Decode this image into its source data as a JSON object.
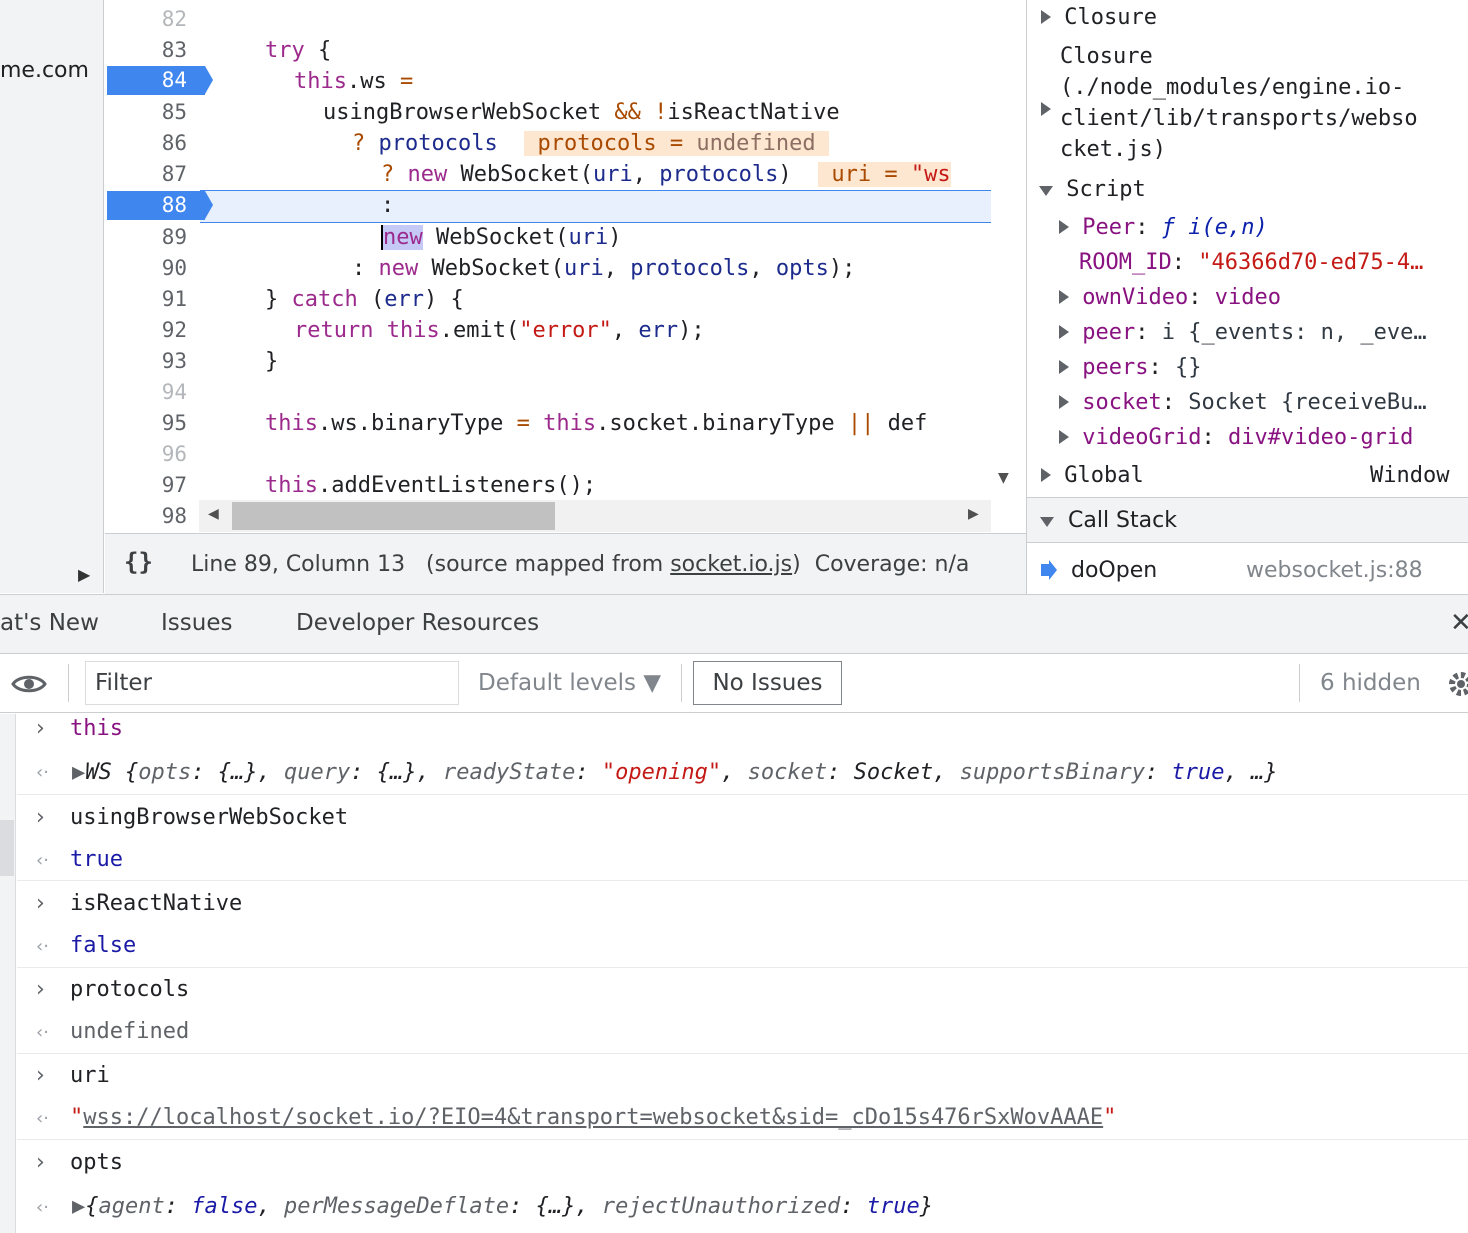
{
  "left_panel": {
    "url_fragment": "me.com",
    "expand_glyph": "▶"
  },
  "editor": {
    "lines": [
      {
        "n": "82"
      },
      {
        "n": "83"
      },
      {
        "n": "84"
      },
      {
        "n": "85"
      },
      {
        "n": "86"
      },
      {
        "n": "87"
      },
      {
        "n": "88"
      },
      {
        "n": "89"
      },
      {
        "n": "90"
      },
      {
        "n": "91"
      },
      {
        "n": "92"
      },
      {
        "n": "93"
      },
      {
        "n": "94"
      },
      {
        "n": "95"
      },
      {
        "n": "96"
      },
      {
        "n": "97"
      },
      {
        "n": "98"
      }
    ],
    "code": {
      "l83_try": "try",
      "l83_brace": " {",
      "l84_this": "this",
      "l84_rest": ".ws ",
      "l84_eq": "=",
      "l85_ident": "usingBrowserWebSocket ",
      "l85_and": "&&",
      "l85_not": " !",
      "l85_rn": "isReactNative",
      "l86_q": "? ",
      "l86_protocols": "protocols",
      "l86_inline": "protocols = ",
      "l86_inline_val": "undefined",
      "l87_q": "? ",
      "l87_new": "new",
      "l87_ws": " WebSocket(",
      "l87_uri": "uri",
      "l87_comma": ", ",
      "l87_protocols": "protocols",
      "l87_close": ")",
      "l87_inline": "uri = ",
      "l87_inline_val": "\"ws",
      "l88_colon": ":",
      "l89_new": "new",
      "l89_ws": " WebSocket(",
      "l89_uri": "uri",
      "l89_close": ")",
      "l90_colon": ": ",
      "l90_new": "new",
      "l90_ws": " WebSocket(",
      "l90_uri": "uri",
      "l90_c1": ", ",
      "l90_protocols": "protocols",
      "l90_c2": ", ",
      "l90_opts": "opts",
      "l90_close": ");",
      "l91_brace": "} ",
      "l91_catch": "catch",
      "l91_rest": " (",
      "l91_err": "err",
      "l91_close": ") {",
      "l92_return": "return",
      "l92_sp": " ",
      "l92_this": "this",
      "l92_emit": ".emit(",
      "l92_str": "\"error\"",
      "l92_comma": ", ",
      "l92_err": "err",
      "l92_close": ");",
      "l93_brace": "}",
      "l95_this": "this",
      "l95_a": ".ws.binaryType ",
      "l95_eq": "=",
      "l95_sp": " ",
      "l95_this2": "this",
      "l95_b": ".socket.binaryType ",
      "l95_or": "||",
      "l95_def": " def",
      "l97_this": "this",
      "l97_rest": ".addEventListeners();"
    }
  },
  "status_bar": {
    "pretty_print": "{}",
    "position": "Line 89, Column 13",
    "source_prefix": "(source mapped from ",
    "source_link": "socket.io.js",
    "source_suffix": ")",
    "coverage": "Coverage: n/a"
  },
  "scope": {
    "closure1": "Closure",
    "closure2_l1": "Closure",
    "closure2_l2": "(./node_modules/engine.io-",
    "closure2_l3": "client/lib/transports/webso",
    "closure2_l4": "cket.js)",
    "script": "Script",
    "props": [
      {
        "k": "Peer",
        "v": "ƒ i(e,n)"
      },
      {
        "k": "ROOM_ID",
        "v": "\"46366d70-ed75-4…"
      },
      {
        "k": "ownVideo",
        "v": "video"
      },
      {
        "k": "peer",
        "v": "i {_events: n, _eve…"
      },
      {
        "k": "peers",
        "v": "{}"
      },
      {
        "k": "socket",
        "v": "Socket {receiveBu…"
      },
      {
        "k": "videoGrid",
        "v": "div#video-grid"
      }
    ],
    "global": "Global",
    "global_value": "Window"
  },
  "call_stack": {
    "title": "Call Stack",
    "frame_name": "doOpen",
    "frame_location": "websocket.js:88"
  },
  "drawer": {
    "tabs": [
      "at's New",
      "Issues",
      "Developer Resources"
    ],
    "close_glyph": "✕"
  },
  "console_toolbar": {
    "filter_placeholder": "Filter",
    "levels": "Default levels",
    "issues_button": "No Issues",
    "hidden": "6 hidden"
  },
  "console": {
    "entries": [
      {
        "input": "this"
      },
      {
        "input": "usingBrowserWebSocket",
        "result": "true"
      },
      {
        "input": "isReactNative",
        "result": "false"
      },
      {
        "input": "protocols",
        "result": "undefined"
      },
      {
        "input": "uri",
        "result": "wss://localhost/socket.io/?EIO=4&transport=websocket&sid=_cDo15s476rSxWovAAAE"
      },
      {
        "input": "opts"
      }
    ],
    "ws_result": {
      "name": "WS",
      "p1": "opts",
      "v1": "{…}",
      "p2": "query",
      "v2": "{…}",
      "p3": "readyState",
      "v3": "\"opening\"",
      "p4": "socket",
      "v4": "Socket",
      "p5": "supportsBinary",
      "v5": "true",
      "tail": "…}"
    },
    "opts_result": {
      "p1": "agent",
      "v1": "false",
      "p2": "perMessageDeflate",
      "v2": "{…}",
      "p3": "rejectUnauthorized",
      "v3": "true"
    }
  },
  "colors": {
    "breakpoint": "#3f86ef",
    "keyword": "#9c2a8c",
    "string": "#c41a16"
  }
}
